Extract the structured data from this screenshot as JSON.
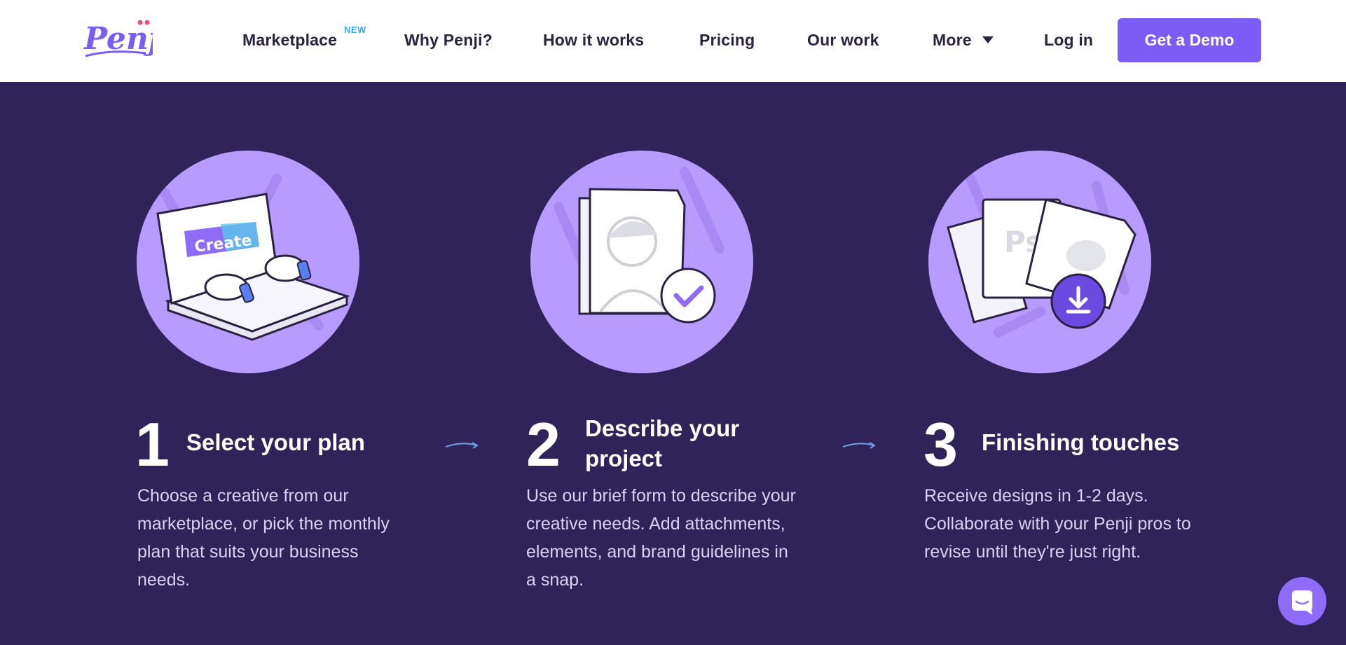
{
  "header": {
    "logo_text": "Penji",
    "nav": [
      {
        "label": "Marketplace",
        "badge": "NEW"
      },
      {
        "label": "Why Penji?"
      },
      {
        "label": "How it works"
      },
      {
        "label": "Pricing"
      },
      {
        "label": "Our work"
      },
      {
        "label": "More"
      },
      {
        "label": "Log in"
      }
    ],
    "cta_label": "Get a Demo"
  },
  "steps": [
    {
      "number": "1",
      "title": "Select your plan",
      "description": "Choose a creative from our marketplace, or pick the monthly plan that suits your business needs.",
      "illustration": "laptop-create-illustration",
      "illustration_label": "Create"
    },
    {
      "number": "2",
      "title": "Describe your project",
      "description": "Use our brief form to describe your creative needs. Add attachments, elements, and brand guidelines in a snap.",
      "illustration": "brief-document-check-illustration"
    },
    {
      "number": "3",
      "title": "Finishing touches",
      "description": "Receive designs in 1-2 days. Collaborate with your Penji pros to revise until they're just right.",
      "illustration": "designs-download-illustration",
      "illustration_label": "Ps"
    }
  ],
  "colors": {
    "background": "#30235a",
    "accent": "#7c5cf6",
    "circle": "#b89bff",
    "badge": "#3aa9e6"
  },
  "chat": {
    "icon": "chat-icon"
  }
}
